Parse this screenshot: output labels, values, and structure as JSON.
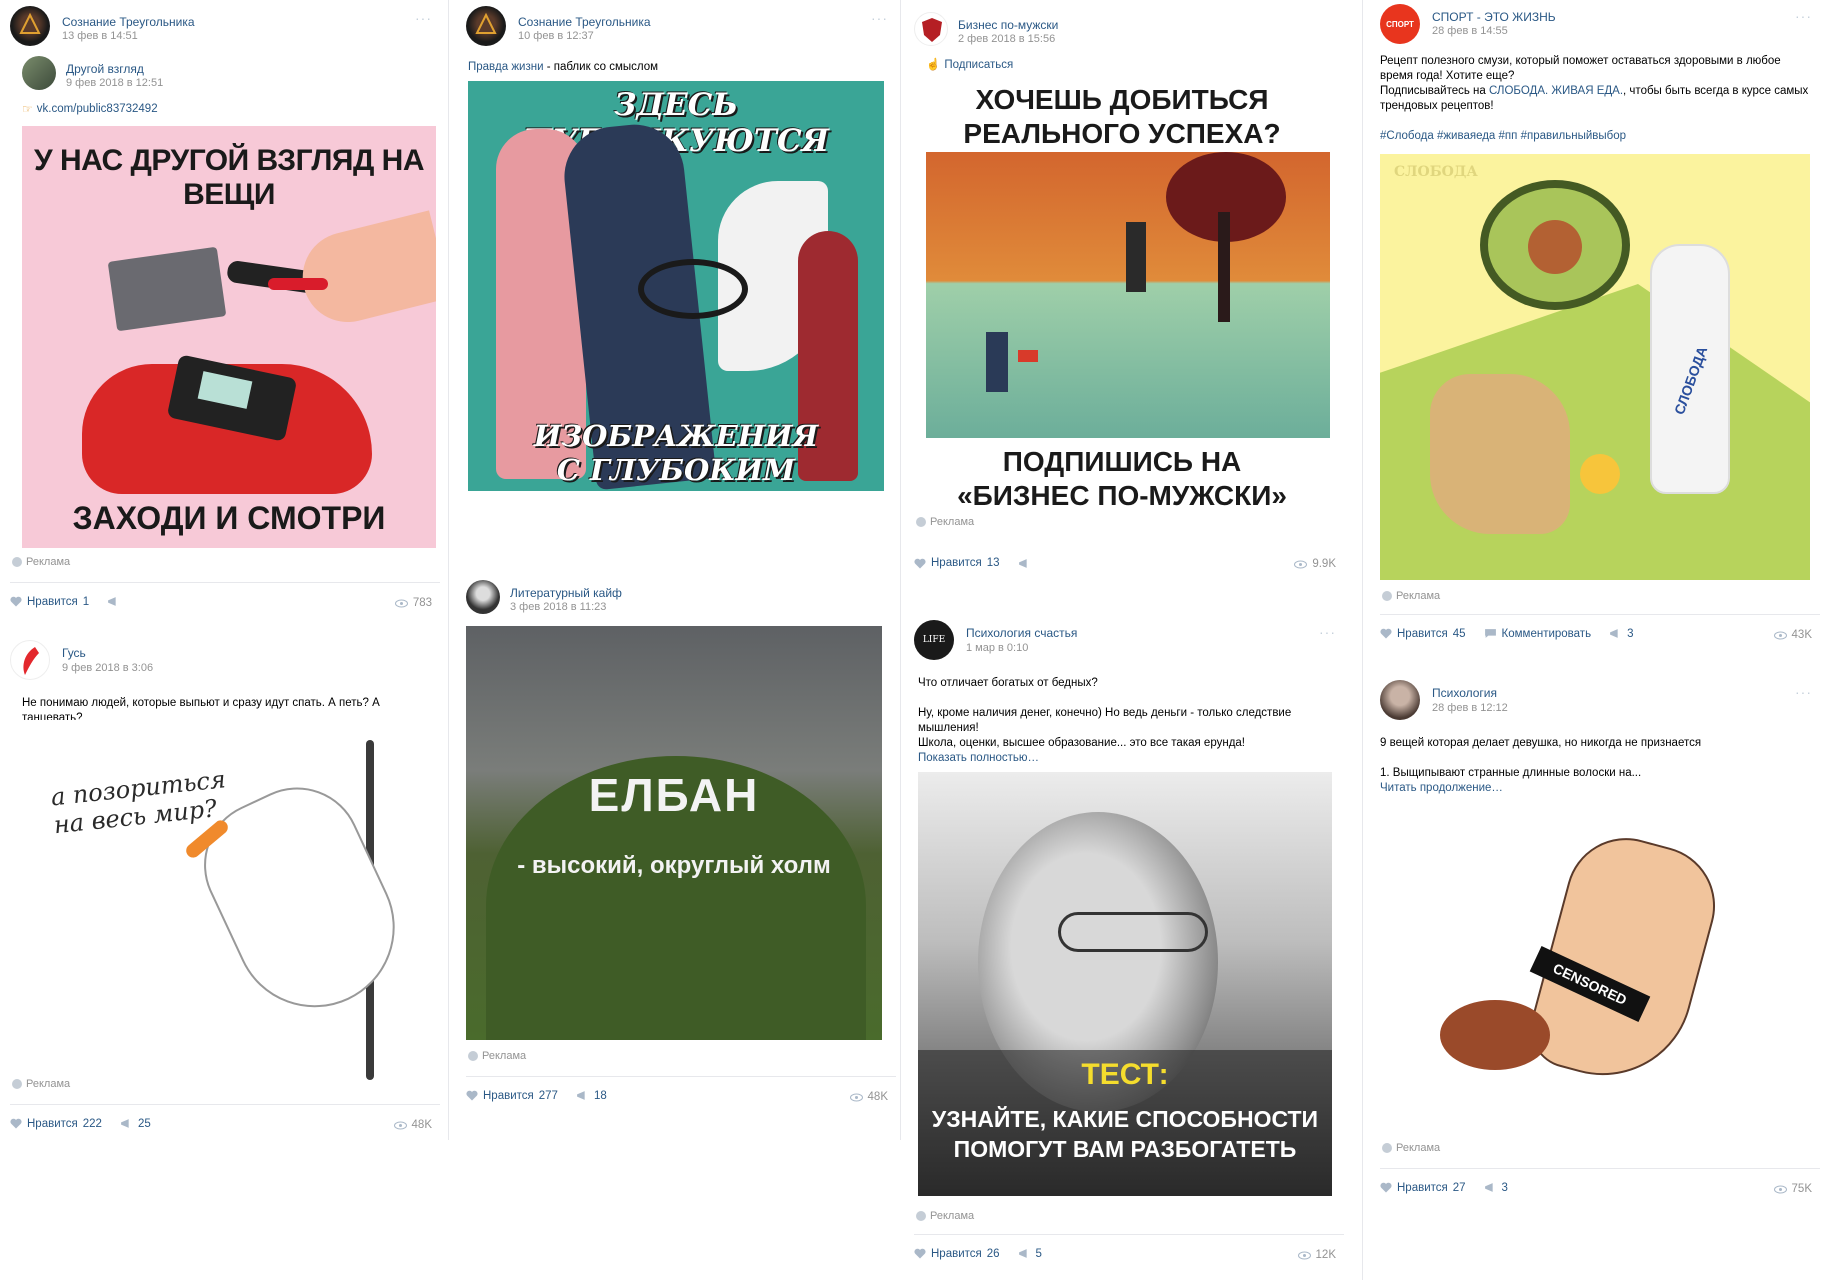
{
  "ad_label": "Реклама",
  "like_label": "Нравится",
  "comment_label": "Комментировать",
  "posts": {
    "p1": {
      "author": "Сознание Треугольника",
      "date": "13 фев в 14:51",
      "repost_author": "Другой взгляд",
      "repost_date": "9 фев 2018 в 12:51",
      "link": "vk.com/public83732492",
      "image_top": "У НАС ДРУГОЙ ВЗГЛЯД НА ВЕЩИ",
      "image_bottom": "ЗАХОДИ И СМОТРИ",
      "likes": "1",
      "views": "783"
    },
    "p2": {
      "author": "Гусь",
      "date": "9 фев 2018 в 3:06",
      "text": "Не понимаю людей, которые выпьют и сразу идут спать. А петь? А танцевать?",
      "image_text": "а позориться на весь мир?",
      "likes": "222",
      "shares": "25",
      "views": "48K"
    },
    "p3": {
      "author": "Сознание Треугольника",
      "date": "10 фев в 12:37",
      "text_bold": "Правда жизни",
      "text_rest": " - паблик со смыслом",
      "image_top": "ЗДЕСЬ ПУБЛИКУЮТСЯ",
      "image_bottom1": "ИЗОБРАЖЕНИЯ",
      "image_bottom2": "С ГЛУБОКИМ МЫСЛОМ"
    },
    "p4": {
      "author": "Литературный кайф",
      "date": "3 фев 2018 в 11:23",
      "image_title": "ЕЛБАН",
      "image_sub": "- высокий, округлый холм",
      "likes": "277",
      "shares": "18",
      "views": "48K"
    },
    "p5": {
      "author": "Бизнес по-мужски",
      "date": "2 фев 2018 в 15:56",
      "subscribe": "Подписаться",
      "image_top1": "ХОЧЕШЬ ДОБИТЬСЯ",
      "image_top2": "РЕАЛЬНОГО УСПЕХА?",
      "image_bottom1": "ПОДПИШИСЬ НА",
      "image_bottom2": "«БИЗНЕС ПО-МУЖСКИ»",
      "likes": "13",
      "views": "9.9K"
    },
    "p6": {
      "author": "Психология счастья",
      "date": "1 мар в 0:10",
      "text1": "Что отличает богатых от бедных?",
      "text2": "Ну, кроме наличия денег, конечно) Но ведь деньги - только следствие мышления!",
      "text3": "Школа, оценки, высшее образование... это все такая ерунда!",
      "show_more": "Показать полностью…",
      "image_test": "ТЕСТ:",
      "image_line1": "УЗНАЙТЕ, КАКИЕ СПОСОБНОСТИ",
      "image_line2": "ПОМОГУТ ВАМ РАЗБОГАТЕТЬ",
      "avatar_text": "LIFE",
      "likes": "26",
      "shares": "5",
      "views": "12K"
    },
    "p7": {
      "author": "СПОРТ - ЭТО ЖИЗНЬ",
      "date": "28 фев в 14:55",
      "text1": "Рецепт полезного смузи, который поможет оставаться здоровыми в любое время года! Хотите еще?",
      "text2a": "Подписывайтесь на ",
      "text2link": "СЛОБОДА. ЖИВАЯ ЕДА.",
      "text2b": ", чтобы быть всегда в курсе самых трендовых рецептов!",
      "hashtags": "#Слобода #живаяеда #пп #правильныйвыбор",
      "brand": "СЛОБОДА",
      "avatar_text": "СПОРТ",
      "likes": "45",
      "shares": "3",
      "views": "43K"
    },
    "p8": {
      "author": "Психология",
      "date": "28 фев в 12:12",
      "text1": "9 вещей которая делает девушка, но никогда не признается",
      "text2": "1. Выщипывают странные длинные волоски на...",
      "read_more": "Читать продолжение…",
      "censored": "CENSORED",
      "likes": "27",
      "shares": "3",
      "views": "75K"
    }
  },
  "colors": {
    "link": "#2a5885",
    "muted": "#939393",
    "divider": "#e7e8ec"
  }
}
